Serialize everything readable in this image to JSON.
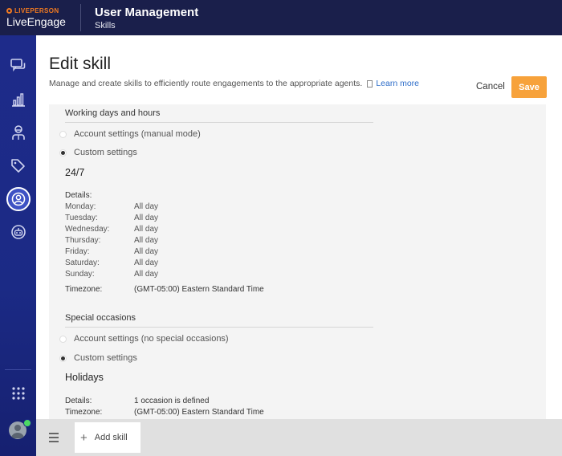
{
  "brand": {
    "logo_top": "LIVEPERSON",
    "logo_bottom": "LiveEngage"
  },
  "header": {
    "title": "User Management",
    "subtitle": "Skills"
  },
  "sidebar": {
    "items": [
      {
        "icon": "chat-icon"
      },
      {
        "icon": "bar-chart-icon"
      },
      {
        "icon": "agent-icon"
      },
      {
        "icon": "tag-icon"
      },
      {
        "icon": "users-icon",
        "active": true
      },
      {
        "icon": "bot-icon"
      },
      {
        "icon": "apps-grid-icon"
      }
    ]
  },
  "page": {
    "title": "Edit skill",
    "description": "Manage and create skills to efficiently route engagements to the appropriate agents.",
    "learn_more": "Learn more",
    "cancel_label": "Cancel",
    "save_label": "Save"
  },
  "working_hours": {
    "section_title": "Working days and hours",
    "option_account": "Account settings (manual mode)",
    "option_custom": "Custom settings",
    "selected": "custom",
    "schedule_title": "24/7",
    "details_label": "Details:",
    "days": [
      {
        "day": "Monday:",
        "hours": "All day"
      },
      {
        "day": "Tuesday:",
        "hours": "All day"
      },
      {
        "day": "Wednesday:",
        "hours": "All day"
      },
      {
        "day": "Thursday:",
        "hours": "All day"
      },
      {
        "day": "Friday:",
        "hours": "All day"
      },
      {
        "day": "Saturday:",
        "hours": "All day"
      },
      {
        "day": "Sunday:",
        "hours": "All day"
      }
    ],
    "timezone_label": "Timezone:",
    "timezone_value": "(GMT-05:00) Eastern Standard Time"
  },
  "special_occasions": {
    "section_title": "Special occasions",
    "option_account": "Account settings (no special occasions)",
    "option_custom": "Custom settings",
    "selected": "custom",
    "block_title": "Holidays",
    "details_label": "Details:",
    "details_value": "1 occasion is defined",
    "timezone_label": "Timezone:",
    "timezone_value": "(GMT-05:00) Eastern Standard Time"
  },
  "footer": {
    "add_skill_label": "Add skill"
  },
  "colors": {
    "header_bg": "#1a1f4b",
    "sidebar_bg": "#1e2b8a",
    "accent_orange": "#f7a23b",
    "link": "#2d6dc9",
    "online": "#4cd964"
  }
}
